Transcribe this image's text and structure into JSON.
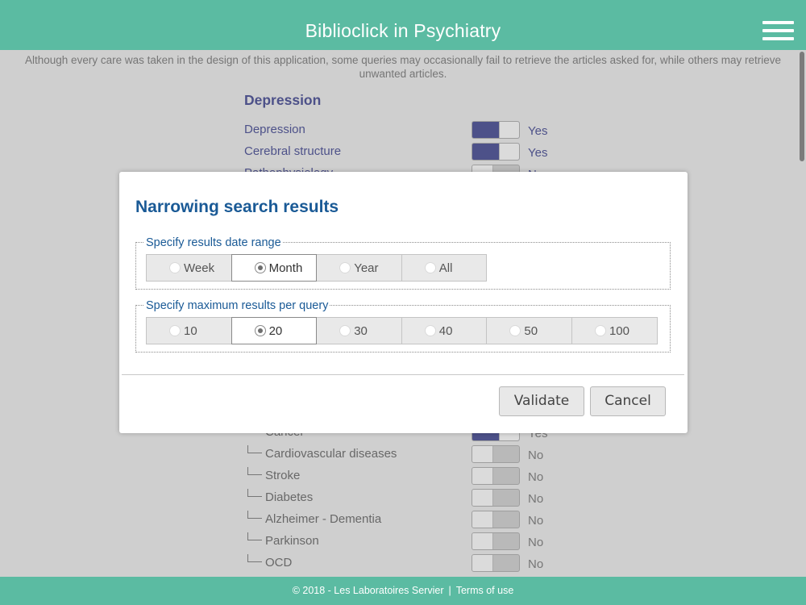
{
  "header": {
    "title": "Biblioclick in Psychiatry",
    "menu_icon": "hamburger-icon"
  },
  "disclaimer": "Although every care was taken in the design of this application, some queries may occasionally fail to retrieve the articles asked for, while others may retrieve unwanted articles.",
  "section": {
    "title": "Depression",
    "rows": [
      {
        "label": "Depression",
        "state": "Yes",
        "on": true
      },
      {
        "label": "Cerebral structure",
        "state": "Yes",
        "on": true
      },
      {
        "label": "Pathophysiology",
        "state": "No",
        "on": false
      }
    ],
    "sub_rows": [
      {
        "label": "Cancer",
        "state": "Yes",
        "on": true
      },
      {
        "label": "Cardiovascular diseases",
        "state": "No",
        "on": false
      },
      {
        "label": "Stroke",
        "state": "No",
        "on": false
      },
      {
        "label": "Diabetes",
        "state": "No",
        "on": false
      },
      {
        "label": "Alzheimer - Dementia",
        "state": "No",
        "on": false
      },
      {
        "label": "Parkinson",
        "state": "No",
        "on": false
      },
      {
        "label": "OCD",
        "state": "No",
        "on": false
      }
    ]
  },
  "modal": {
    "title": "Narrowing search results",
    "date_range": {
      "legend": "Specify results date range",
      "options": [
        "Week",
        "Month",
        "Year",
        "All"
      ],
      "selected": "Month"
    },
    "max_results": {
      "legend": "Specify maximum results per query",
      "options": [
        "10",
        "20",
        "30",
        "40",
        "50",
        "100"
      ],
      "selected": "20"
    },
    "validate_label": "Validate",
    "cancel_label": "Cancel"
  },
  "footer": {
    "copyright": "© 2018 - Les Laboratoires Servier",
    "separator": "|",
    "terms_label": "Terms of use"
  },
  "colors": {
    "header_bg": "#5bbba2",
    "accent_purple": "#5a5fa0",
    "modal_blue": "#1a5a96"
  }
}
